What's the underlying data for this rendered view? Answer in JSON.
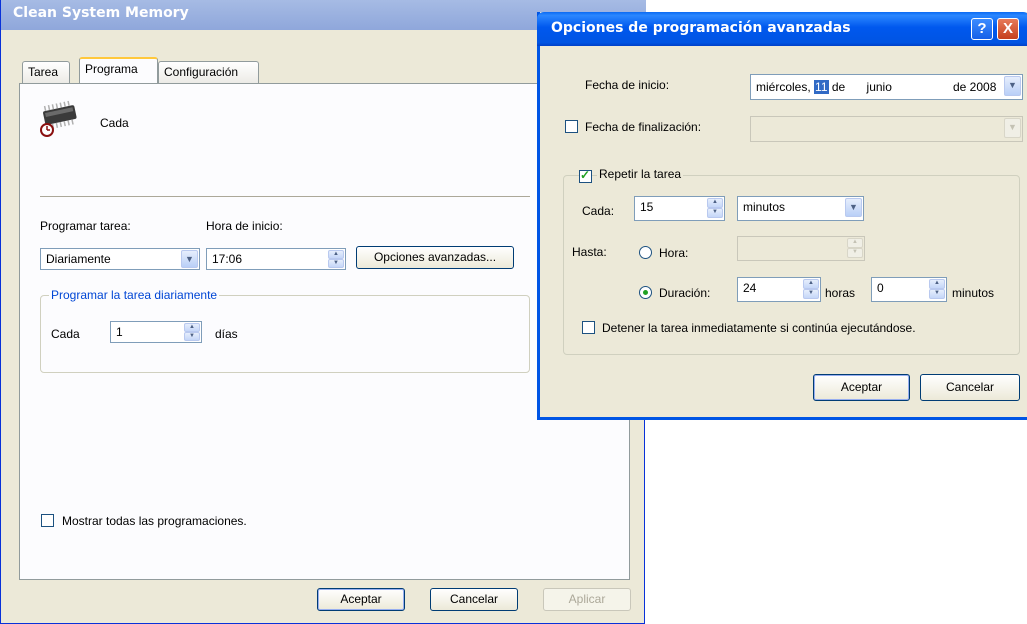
{
  "main_window": {
    "title": "Clean System Memory",
    "tabs": [
      {
        "label": "Tarea"
      },
      {
        "label": "Programa"
      },
      {
        "label": "Configuración"
      }
    ],
    "summary_text": "Cada",
    "schedule_task_label": "Programar tarea:",
    "schedule_task_value": "Diariamente",
    "start_time_label": "Hora de inicio:",
    "start_time_value": "17:06",
    "advanced_button": "Opciones avanzadas...",
    "daily_group_title": "Programar la tarea diariamente",
    "every_label": "Cada",
    "every_value": "1",
    "days_label": "días",
    "show_all_label": "Mostrar todas las programaciones.",
    "show_all_checked": false,
    "ok_button": "Aceptar",
    "cancel_button": "Cancelar",
    "apply_button": "Aplicar"
  },
  "advanced_dialog": {
    "title": "Opciones de programación avanzadas",
    "help_icon": "?",
    "close_icon": "X",
    "start_date_label": "Fecha de inicio:",
    "start_date": {
      "weekday": "miércoles,",
      "day": "11",
      "de1": "de",
      "month": "junio",
      "year_text": "de 2008"
    },
    "end_date_label": "Fecha de finalización:",
    "end_date_checked": false,
    "repeat_label": "Repetir la tarea",
    "repeat_checked": true,
    "every_label": "Cada:",
    "every_value": "15",
    "every_unit": "minutos",
    "until_label": "Hasta:",
    "time_option_label": "Hora:",
    "duration_option_label": "Duración:",
    "selected_option": "duration",
    "duration_hours": "24",
    "hours_label": "horas",
    "duration_minutes": "0",
    "minutes_label": "minutos",
    "stop_label": "Detener la tarea inmediatamente si continúa ejecutándose.",
    "stop_checked": false,
    "ok_button": "Aceptar",
    "cancel_button": "Cancelar"
  },
  "colors": {
    "dialog_title_bar": "#0054e3",
    "inactive_title_bar": "#8fa7db",
    "group_title": "#0046d5",
    "selection": "#316ac5"
  }
}
